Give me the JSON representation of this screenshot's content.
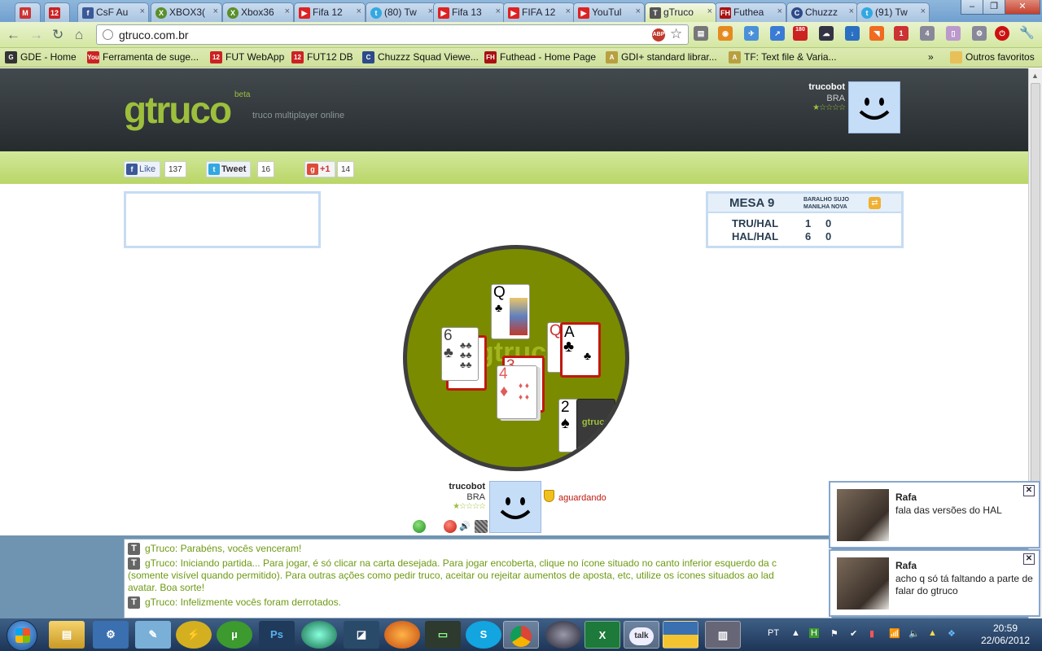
{
  "browser": {
    "tabs": [
      {
        "label": "",
        "icon": "gmail-icon"
      },
      {
        "label": "",
        "icon": "fut12-icon"
      },
      {
        "label": "CsF Au",
        "icon": "facebook-icon"
      },
      {
        "label": "XBOX3(",
        "icon": "xbox-icon"
      },
      {
        "label": "Xbox36",
        "icon": "xbox-icon"
      },
      {
        "label": "Fifa 12",
        "icon": "youtube-icon"
      },
      {
        "label": "(80) Tw",
        "icon": "twitter-icon"
      },
      {
        "label": "Fifa 13",
        "icon": "youtube-icon"
      },
      {
        "label": "FIFA 12",
        "icon": "youtube-icon"
      },
      {
        "label": "YouTul",
        "icon": "youtube-icon"
      },
      {
        "label": "gTruco",
        "icon": "gtruco-icon"
      },
      {
        "label": "Futhea",
        "icon": "futhead-icon"
      },
      {
        "label": "Chuzzz",
        "icon": "chuzzz-icon"
      },
      {
        "label": "(91) Tw",
        "icon": "twitter-icon"
      }
    ],
    "url": "gtruco.com.br",
    "bookmarks": [
      {
        "label": "GDE - Home",
        "icon": "gde-icon"
      },
      {
        "label": "Ferramenta de suge...",
        "icon": "youtube-icon"
      },
      {
        "label": "FUT WebApp",
        "icon": "fut12-icon"
      },
      {
        "label": "FUT12 DB",
        "icon": "fut12-icon"
      },
      {
        "label": "Chuzzz Squad Viewe...",
        "icon": "chuzzz-icon"
      },
      {
        "label": "Futhead - Home Page",
        "icon": "futhead-icon"
      },
      {
        "label": "GDI+ standard librar...",
        "icon": "doc-icon"
      },
      {
        "label": "TF: Text file & Varia...",
        "icon": "doc-icon"
      }
    ],
    "other_bookmarks": "Outros favoritos",
    "extension_badges": {
      "youtube": "180",
      "gmail": "1",
      "eye": "4"
    }
  },
  "site": {
    "logo": "gtruco",
    "beta": "beta",
    "tagline": "truco multiplayer online",
    "header_user": {
      "name": "trucobot",
      "country": "BRA",
      "rating": "★☆☆☆☆"
    },
    "social": {
      "like_label": "Like",
      "like_count": "137",
      "tweet_label": "Tweet",
      "tweet_count": "16",
      "plus_label": "+1",
      "plus_count": "14"
    }
  },
  "scoreboard": {
    "title": "MESA 9",
    "option1": "BARALHO SUJO",
    "option2": "MANILHA NOVA",
    "rows": [
      {
        "team": "TRU/HAL",
        "a": "1",
        "b": "0"
      },
      {
        "team": "HAL/HAL",
        "a": "6",
        "b": "0"
      }
    ]
  },
  "game_table": {
    "watermark": "gtruco",
    "cards": {
      "top": {
        "rank": "Q",
        "suit": "♣"
      },
      "left": {
        "rank": "6",
        "suit": "♣"
      },
      "right": {
        "rank": "A",
        "suit": "♣"
      },
      "center": {
        "rank": "4",
        "suit": "♦"
      },
      "center_back_rank": "3",
      "right_back_rank": "Q",
      "vira": {
        "rank": "2",
        "suit": "♠"
      }
    },
    "deck_label": "gtruco"
  },
  "player": {
    "name": "trucobot",
    "country": "BRA",
    "rating": "★☆☆☆☆",
    "status": "aguardando"
  },
  "chat": {
    "messages": [
      "gTruco: Parabéns, vocês venceram!",
      "gTruco: Iniciando partida... Para jogar, é só clicar na carta desejada. Para jogar encoberta, clique no ícone situado no canto inferior esquerdo da c",
      "(somente visível quando permitido). Para outras ações como pedir truco, aceitar ou rejeitar aumentos de aposta, etc, utilize os ícones situados ao lad",
      "avatar. Boa sorte!",
      "gTruco: Infelizmente vocês foram derrotados."
    ]
  },
  "notifications": [
    {
      "name": "Rafa",
      "text": "fala das versões do HAL"
    },
    {
      "name": "Rafa",
      "text": "acho q só tá faltando a parte de falar do gtruco"
    }
  ],
  "taskbar": {
    "language": "PT",
    "time": "20:59",
    "date": "22/06/2012",
    "apps": [
      "explorer",
      "control-panel",
      "notepad",
      "winamp",
      "utorrent",
      "photoshop",
      "media-center",
      "gadget",
      "firefox",
      "terminal",
      "skype",
      "chrome",
      "camera",
      "excel",
      "gtalk",
      "python",
      "scanner"
    ],
    "labels": {
      "ps": "Ps",
      "talk": "talk",
      "excel": "X"
    }
  }
}
